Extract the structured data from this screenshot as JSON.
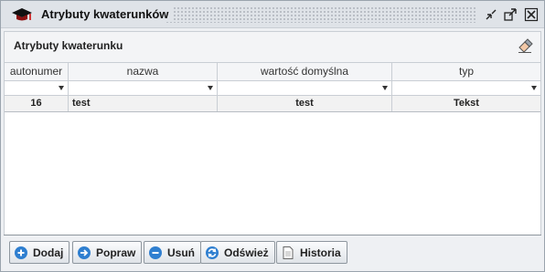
{
  "window": {
    "title": "Atrybuty kwaterunków"
  },
  "panel": {
    "title": "Atrybuty kwaterunku"
  },
  "table": {
    "columns": [
      "autonumer",
      "nazwa",
      "wartość domyślna",
      "typ"
    ],
    "rows": [
      {
        "autonumer": "16",
        "nazwa": "test",
        "wartosc": "test",
        "typ": "Tekst"
      }
    ]
  },
  "toolbar": {
    "add": "Dodaj",
    "edit": "Popraw",
    "delete": "Usuń",
    "refresh": "Odśwież",
    "history": "Historia"
  },
  "icons": {
    "window": "graduation-cap-icon",
    "minimize": "collapse-icon",
    "maximize": "expand-icon",
    "close": "close-icon",
    "panel": "eraser-icon"
  },
  "colors": {
    "add": "#2f7fd0",
    "edit": "#2f7fd0",
    "delete": "#2f7fd0",
    "refresh": "#2f7fd0"
  }
}
